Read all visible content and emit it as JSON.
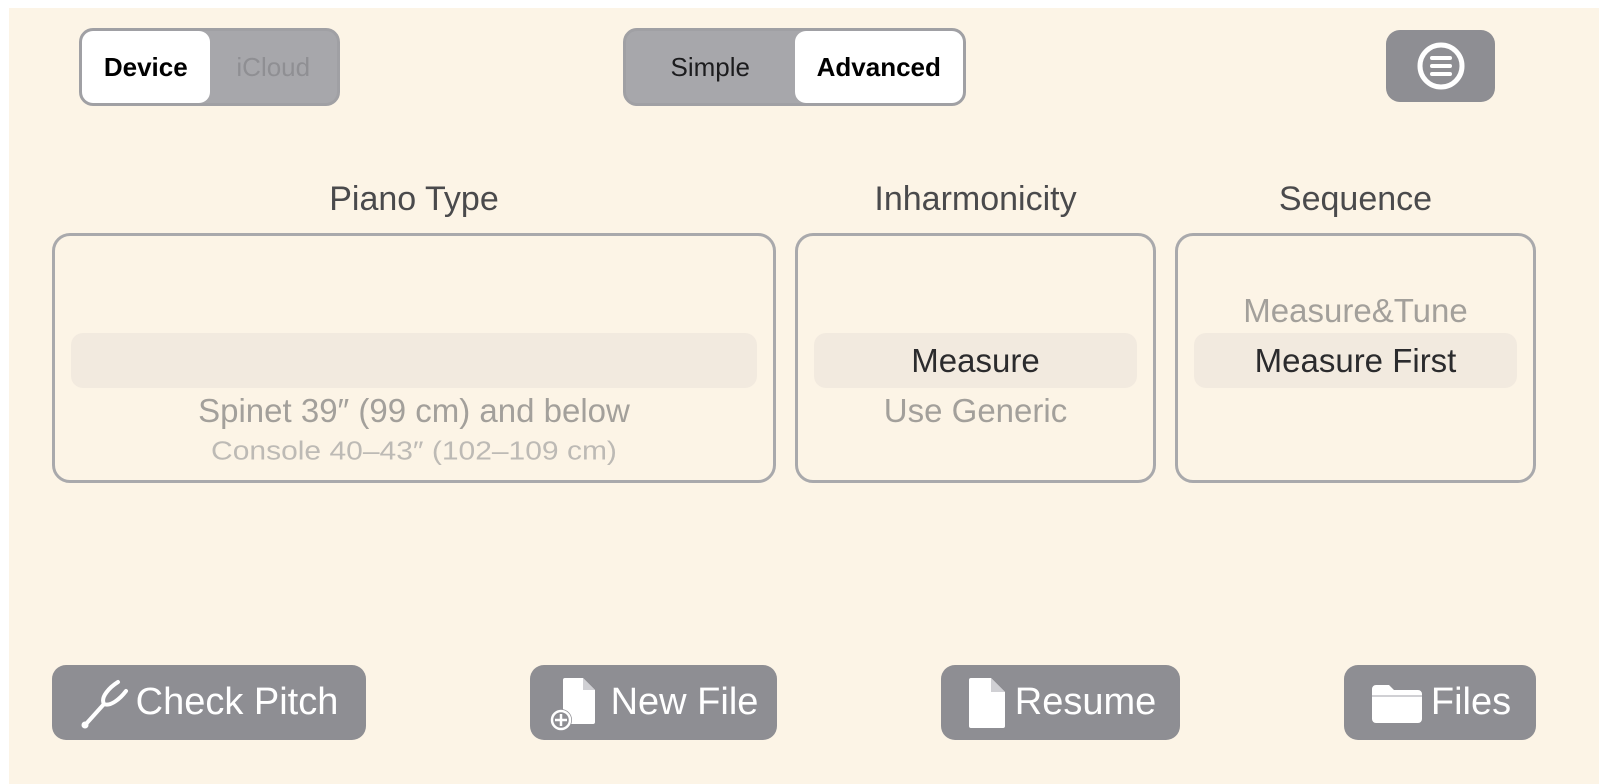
{
  "storage_toggle": {
    "options": [
      "Device",
      "iCloud"
    ],
    "selected": "Device"
  },
  "mode_toggle": {
    "options": [
      "Simple",
      "Advanced"
    ],
    "selected": "Advanced"
  },
  "menu_button": {
    "icon": "list-circle-icon"
  },
  "piano_type": {
    "title": "Piano Type",
    "selected": "",
    "options_below": [
      "Spinet 39″ (99 cm) and below",
      "Console 40–43″ (102–109 cm)"
    ]
  },
  "inharmonicity": {
    "title": "Inharmonicity",
    "selected": "Measure",
    "options_below": [
      "Use Generic"
    ]
  },
  "sequence": {
    "title": "Sequence",
    "option_above": "Measure&Tune",
    "selected": "Measure First"
  },
  "actions": {
    "check_pitch": {
      "label": "Check Pitch",
      "icon": "tuning-fork-icon"
    },
    "new_file": {
      "label": "New File",
      "icon": "doc-add-icon"
    },
    "resume": {
      "label": "Resume",
      "icon": "doc-icon"
    },
    "files": {
      "label": "Files",
      "icon": "folder-icon"
    }
  },
  "colors": {
    "background": "#fcf4e6",
    "button": "#8e8e93",
    "segment_track": "#a7a7ab"
  }
}
